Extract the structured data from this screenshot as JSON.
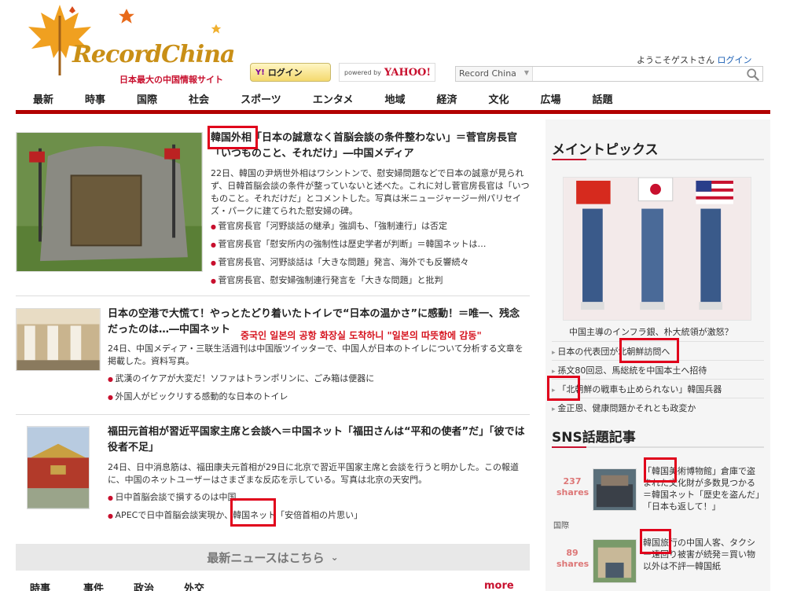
{
  "header": {
    "logo_text": "RecordChina",
    "logo_sub": "日本最大の中国情報サイト",
    "login_button": "ログイン",
    "login_button_prefix": "Y!",
    "powered_by": "powered by",
    "powered_brand": "YAHOO!",
    "welcome": "ようこそゲストさん",
    "welcome_login": "ログイン",
    "search_scope": "Record China",
    "search_placeholder": ""
  },
  "nav": {
    "items": [
      "最新",
      "時事",
      "国際",
      "社会",
      "スポーツ",
      "エンタメ",
      "地域",
      "経済",
      "文化",
      "広場",
      "話題"
    ]
  },
  "articles": [
    {
      "title": "韓国外相「日本の誠意なく首脳会談の条件整わない」＝菅官房長官「いつものこと、それだけ」―中国メディア",
      "body": "22日、韓国の尹炳世外相はワシントンで、慰安婦問題などで日本の誠意が見られず、日韓首脳会談の条件が整っていないと述べた。これに対し菅官房長官は「いつものこと。それだけだ」とコメントした。写真は米ニュージャージー州パリセイズ・パークに建てられた慰安婦の碑。",
      "links": [
        "菅官房長官「河野談話の継承」強調も、「強制連行」は否定",
        "菅官房長官「慰安所内の強制性は歴史学者が判断」＝韓国ネットは…",
        "菅官房長官、河野談話は「大きな問題」発言、海外でも反響続々",
        "菅官房長官、慰安婦強制連行発言を「大きな問題」と批判"
      ]
    },
    {
      "title": "日本の空港で大慌て！やっとたどり着いたトイレで“日本の温かさ”に感動！＝唯一、残念だったのは…―中国ネット",
      "body": "24日、中国メディア・三联生活週刊は中国版ツイッターで、中国人が日本のトイレについて分析する文章を掲載した。資料写真。",
      "links": [
        "武漢のイケアが大変だ！ソファはトランポリンに、ごみ箱は便器に",
        "外国人がビックリする感動的な日本のトイレ"
      ]
    },
    {
      "title": "福田元首相が習近平国家主席と会談へ＝中国ネット「福田さんは“平和の使者”だ」「彼では役者不足」",
      "body": "24日、日中消息筋は、福田康夫元首相が29日に北京で習近平国家主席と会談を行うと明かした。この報道に、中国のネットユーザーはさまざまな反応を示している。写真は北京の天安門。",
      "links": [
        "日中首脳会談で損するのは中国",
        "APECで日中首脳会談実現か、韓国ネット「安倍首相の片思い」"
      ]
    }
  ],
  "overlay_korean": "중국인 일본의 공항 화장실 도착하니 \"일본의 따뜻함에 감동\"",
  "more_news": "最新ニュースはこちら",
  "bottom_tabs": [
    "時事",
    "事件",
    "政治",
    "外交"
  ],
  "bottom_more": "more",
  "sidebar": {
    "main_topics_title": "メイントピックス",
    "photo_caption": "中国主導のインフラ銀、朴大統領が激怒？",
    "links": [
      "日本の代表団が北朝鮮訪問へ",
      "孫文80回忌、馬総統を中国本土へ招待",
      "「北朝鮮の戦車も止められない」韓国兵器",
      "金正恩、健康問題かそれとも政変か"
    ],
    "sns_title": "SNS話題記事",
    "sns_items": [
      {
        "count": "237",
        "unit": "shares",
        "category": "国際",
        "text": "「韓国美術博物館」倉庫で盗まれた文化財が多数見つかる＝韓国ネット「歴史を盗んだ」「日本も返して！」"
      },
      {
        "count": "89",
        "unit": "shares",
        "category": "",
        "text": "韓国旅行の中国人客、タクシー遠回り被害が続発＝買い物以外は不評一韓国紙"
      }
    ]
  },
  "colors": {
    "brand_red": "#b20000",
    "highlight_red": "#e0001b",
    "logo_gold": "#c98f16"
  }
}
